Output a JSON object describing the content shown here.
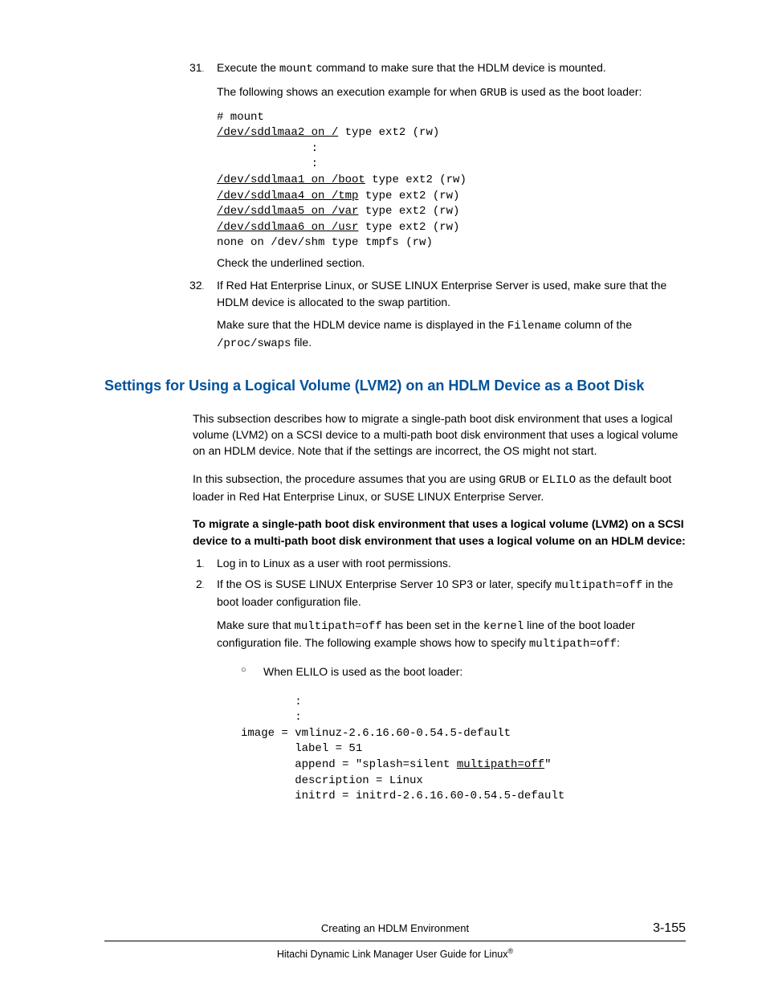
{
  "step31": {
    "num": "31",
    "text_pre": "Execute the ",
    "cmd": "mount",
    "text_post": " command to make sure that the HDLM device is mounted.",
    "para2_pre": "The following shows an execution example for when ",
    "para2_cmd": "GRUB",
    "para2_post": " is used as the boot loader:",
    "code_l1": "# mount",
    "code_l2a": "/dev/sddlmaa2 on /",
    "code_l2b": " type ext2 (rw)",
    "code_l3": "              :",
    "code_l4": "              :",
    "code_l5a": "/dev/sddlmaa1 on /boot",
    "code_l5b": " type ext2 (rw)",
    "code_l6a": "/dev/sddlmaa4 on /tmp",
    "code_l6b": " type ext2 (rw)",
    "code_l7a": "/dev/sddlmaa5 on /var",
    "code_l7b": " type ext2 (rw)",
    "code_l8a": "/dev/sddlmaa6 on /usr",
    "code_l8b": " type ext2 (rw)",
    "code_l9": "none on /dev/shm type tmpfs (rw)",
    "check": "Check the underlined section."
  },
  "step32": {
    "num": "32",
    "p1": "If Red Hat Enterprise Linux, or SUSE LINUX Enterprise Server is used, make sure that the HDLM device is allocated to the swap partition.",
    "p2_pre": "Make sure that the HDLM device name is displayed in the ",
    "p2_m1": "Filename",
    "p2_mid": " column of the ",
    "p2_m2": "/proc/swaps",
    "p2_post": " file."
  },
  "heading": "Settings for Using a Logical Volume (LVM2) on an HDLM Device as a Boot Disk",
  "para1": "This subsection describes how to migrate a single-path boot disk environment that uses a logical volume (LVM2) on a SCSI device to a multi-path boot disk environment that uses a logical volume on an HDLM device. Note that if the settings are incorrect, the OS might not start.",
  "para2_pre": "In this subsection, the procedure assumes that you are using ",
  "para2_m1": "GRUB",
  "para2_mid": " or ",
  "para2_m2": "ELILO",
  "para2_post": " as the default boot loader in Red Hat Enterprise Linux, or SUSE LINUX Enterprise Server.",
  "subhead": "To migrate a single-path boot disk environment that uses a logical volume (LVM2) on a SCSI device to a multi-path boot disk environment that uses a logical volume on an HDLM device:",
  "s1": {
    "num": "1",
    "text": "Log in to Linux as a user with root permissions."
  },
  "s2": {
    "num": "2",
    "p1_pre": "If the OS is SUSE LINUX Enterprise Server 10 SP3 or later, specify ",
    "p1_m": "multipath=off",
    "p1_post": " in the boot loader configuration file.",
    "p2_pre": "Make sure that ",
    "p2_m1": "multipath=off",
    "p2_mid": " has been set in the ",
    "p2_m2": "kernel",
    "p2_post": " line of the boot loader configuration file. The following example shows how to specify ",
    "p2_m3": "multipath=off",
    "p2_end": ":",
    "sub": "When ELILO is used as the boot loader:",
    "c1": "        :",
    "c2": "        :",
    "c3": "image = vmlinuz-2.6.16.60-0.54.5-default",
    "c4": "        label = 51",
    "c5a": "        append = \"splash=silent ",
    "c5b": "multipath=off",
    "c5c": "\"",
    "c6": "        description = Linux",
    "c7": "        initrd = initrd-2.6.16.60-0.54.5-default"
  },
  "footer": {
    "title": "Creating an HDLM Environment",
    "page": "3-155",
    "guide": "Hitachi Dynamic Link Manager User Guide for Linux"
  }
}
